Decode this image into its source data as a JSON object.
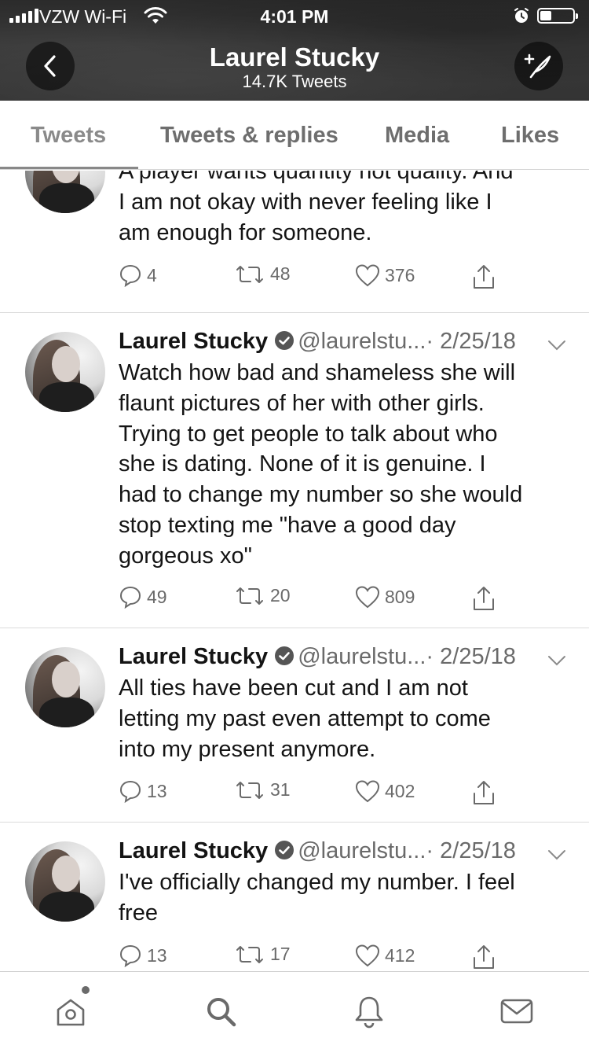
{
  "status_bar": {
    "carrier": "VZW Wi-Fi",
    "time": "4:01 PM"
  },
  "header": {
    "title": "Laurel Stucky",
    "subtitle": "14.7K Tweets",
    "back_icon": "chevron-left-icon",
    "compose_icon": "compose-tweet-icon"
  },
  "tabs": [
    {
      "label": "Tweets",
      "active": true
    },
    {
      "label": "Tweets & replies",
      "active": false
    },
    {
      "label": "Media",
      "active": false
    },
    {
      "label": "Likes",
      "active": false
    }
  ],
  "tweets": [
    {
      "name": "",
      "handle": "",
      "date": "",
      "text": "A player wants quantity not quality. And\nI am not okay with never feeling like I\nam enough for someone.",
      "replies": "4",
      "retweets": "48",
      "likes": "376"
    },
    {
      "name": "Laurel Stucky",
      "handle": "@laurelstu...",
      "date": "· 2/25/18",
      "text": "Watch how bad and shameless she will\nflaunt pictures of her with other girls.\nTrying to get people to talk about who\nshe is dating. None of it is genuine. I\nhad to change my number so she would\nstop texting me \"have a good day\ngorgeous xo\"",
      "replies": "49",
      "retweets": "20",
      "likes": "809"
    },
    {
      "name": "Laurel Stucky",
      "handle": "@laurelstu...",
      "date": "· 2/25/18",
      "text": "All ties have been cut and I am not\nletting my past even attempt to come\ninto my present anymore.",
      "replies": "13",
      "retweets": "31",
      "likes": "402"
    },
    {
      "name": "Laurel Stucky",
      "handle": "@laurelstu...",
      "date": "· 2/25/18",
      "text": "I've officially changed my number. I feel\nfree",
      "replies": "13",
      "retweets": "17",
      "likes": "412"
    }
  ],
  "bottom_nav": {
    "items": [
      "home-icon",
      "search-icon",
      "notifications-bell-icon",
      "messages-envelope-icon"
    ]
  }
}
